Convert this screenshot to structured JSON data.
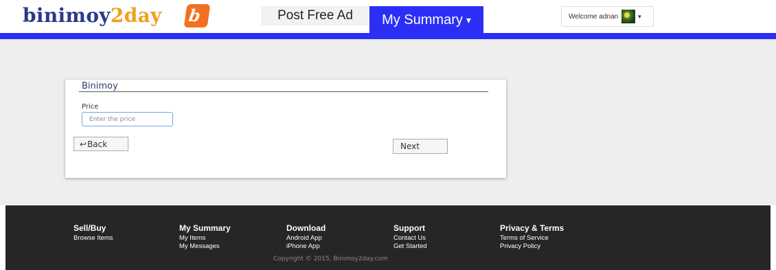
{
  "header": {
    "logo": {
      "part1": "binimoy",
      "part2": "2",
      "part3": "day",
      "mark": "b"
    },
    "nav_post": "Post Free Ad",
    "nav_summary": "My Summary",
    "nav_summary_caret": "▾",
    "welcome": "Welcome adnan",
    "welcome_caret": "▾",
    "accent": "#2b2ff5"
  },
  "form": {
    "title": "Binimoy",
    "price_label": "Price",
    "price_placeholder": "Enter the price",
    "price_value": "",
    "back_icon": "↩",
    "back_label": "Back",
    "next_label": "Next"
  },
  "footer": {
    "columns": [
      {
        "heading": "Sell/Buy",
        "links": [
          "Browse Items"
        ]
      },
      {
        "heading": "My Summary",
        "links": [
          "My Items",
          "My Messages"
        ]
      },
      {
        "heading": "Download",
        "links": [
          "Android App",
          "iPhone App"
        ]
      },
      {
        "heading": "Support",
        "links": [
          "Contact Us",
          "Get Started"
        ]
      },
      {
        "heading": "Privacy & Terms",
        "links": [
          "Terms of Service",
          "Privacy Policy"
        ]
      }
    ],
    "copyright": "Copyright © 2015, Binimoy2day.com"
  }
}
